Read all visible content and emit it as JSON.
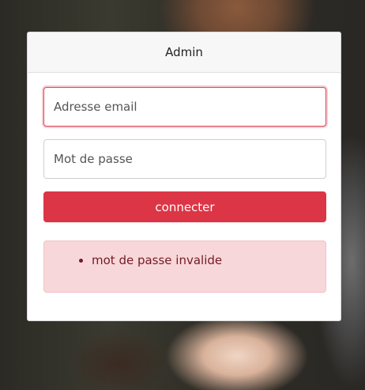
{
  "login": {
    "title": "Admin",
    "email_placeholder": "Adresse email",
    "password_placeholder": "Mot de passe",
    "submit_label": "connecter",
    "errors": [
      "mot de passe invalide"
    ]
  },
  "colors": {
    "accent": "#dc3545",
    "alert_background": "#f8d7da",
    "alert_text": "#721c24"
  }
}
